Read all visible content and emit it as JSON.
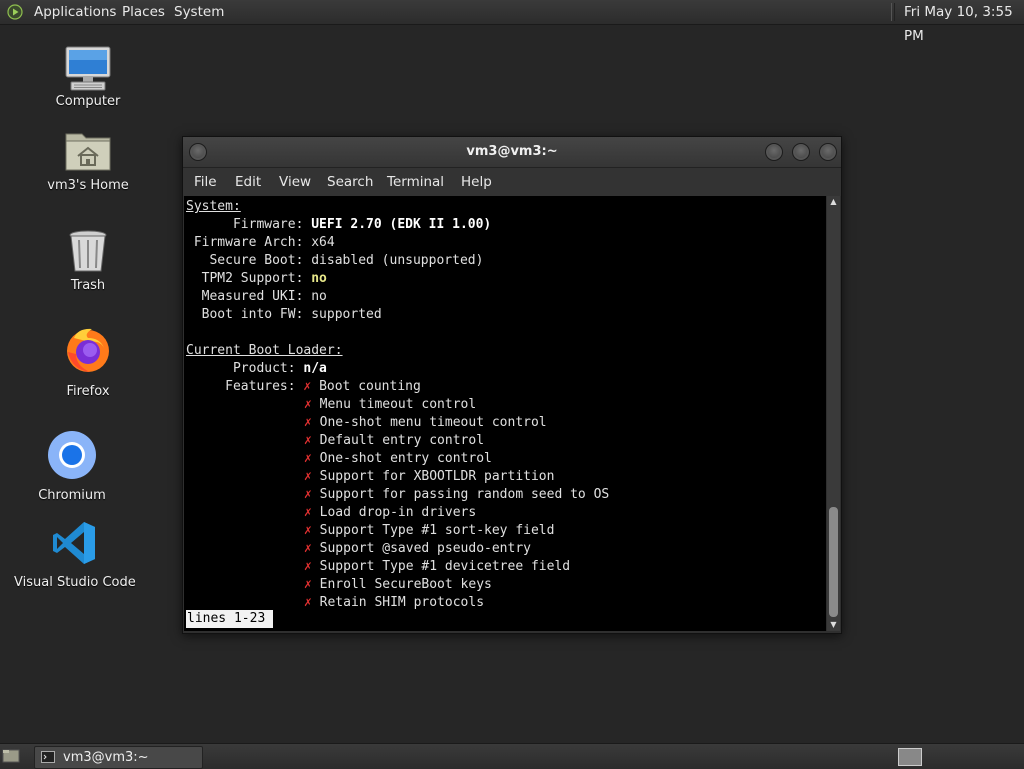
{
  "top_panel": {
    "menus": [
      "Applications",
      "Places",
      "System"
    ],
    "clock": "Fri May 10,  3:55 PM"
  },
  "desktop_icons": [
    {
      "label": "Computer",
      "icon": "computer-icon"
    },
    {
      "label": "vm3's Home",
      "icon": "home-folder-icon"
    },
    {
      "label": "Trash",
      "icon": "trash-icon"
    },
    {
      "label": "Firefox",
      "icon": "firefox-icon"
    },
    {
      "label": "Chromium",
      "icon": "chromium-icon"
    },
    {
      "label": "Visual Studio Code",
      "icon": "vscode-icon"
    }
  ],
  "window": {
    "title": "vm3@vm3:~",
    "menu": [
      "File",
      "Edit",
      "View",
      "Search",
      "Terminal",
      "Help"
    ]
  },
  "terminal": {
    "system_header": "System:",
    "system": [
      {
        "key": "      Firmware: ",
        "value": "UEFI 2.70 (EDK II 1.00)"
      },
      {
        "key": " Firmware Arch: ",
        "value": "x64"
      },
      {
        "key": "   Secure Boot: ",
        "value": "disabled (unsupported)"
      },
      {
        "key": "  TPM2 Support: ",
        "value": "no"
      },
      {
        "key": "  Measured UKI: ",
        "value": "no"
      },
      {
        "key": "  Boot into FW: ",
        "value": "supported"
      }
    ],
    "loader_header": "Current Boot Loader:",
    "product_key": "      Product: ",
    "product_value": "n/a",
    "features_key": "     Features: ",
    "cross_mark": "✗",
    "features": [
      "Boot counting",
      "Menu timeout control",
      "One-shot menu timeout control",
      "Default entry control",
      "One-shot entry control",
      "Support for XBOOTLDR partition",
      "Support for passing random seed to OS",
      "Load drop-in drivers",
      "Support Type #1 sort-key field",
      "Support @saved pseudo-entry",
      "Support Type #1 devicetree field",
      "Enroll SecureBoot keys",
      "Retain SHIM protocols"
    ],
    "status": "lines 1-23"
  },
  "taskbar": {
    "task_label": "vm3@vm3:~"
  }
}
